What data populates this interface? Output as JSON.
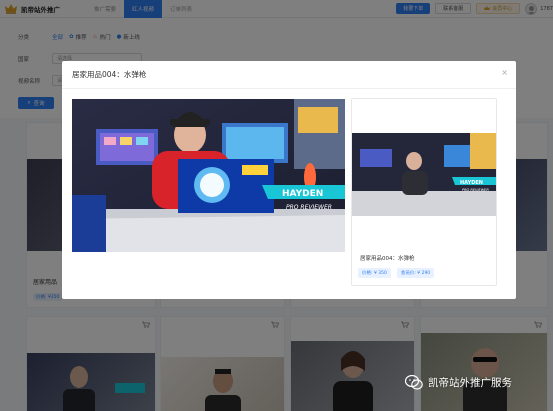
{
  "header": {
    "brand": "凯帝站外推广",
    "tabs": [
      {
        "label": "推广需要",
        "active": false
      },
      {
        "label": "红人视频",
        "active": true
      },
      {
        "label": "订单列表",
        "active": false
      }
    ],
    "download_btn": "我要下单",
    "service_btn": "联系客服",
    "vip_btn": "会员中心",
    "user_id": "1787"
  },
  "filters": {
    "category_label": "分类",
    "categories": [
      "全部",
      "推荐",
      "热门",
      "新上线"
    ],
    "country_label": "国家",
    "country_placeholder": "请选择",
    "video_name_label": "视频名称",
    "video_name_placeholder": "请输",
    "search_btn": "查询"
  },
  "grid": {
    "card_title": "居家用品",
    "card_price": "价格: ¥350"
  },
  "modal": {
    "title": "居家用品004：水弹枪",
    "close_icon": "×",
    "overlay_name": "HAYDEN",
    "overlay_sub": "PRO REVIEWER",
    "side_title": "居家用品004：水弹枪",
    "price": "价格: ¥ 350",
    "member_price": "会员价: ¥ 290"
  },
  "watermark": "凯帝站外推广服务",
  "colors": {
    "accent": "#2f7ef5",
    "overlay_cyan": "#18c6d6"
  }
}
